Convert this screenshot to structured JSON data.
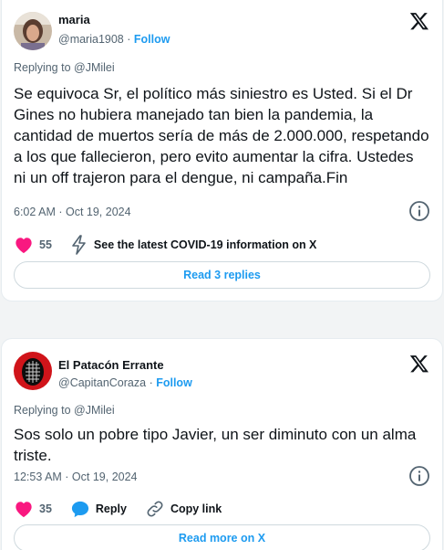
{
  "colors": {
    "accent": "#1d9bf0",
    "like": "#f91880",
    "muted": "#536471",
    "text": "#0f1419"
  },
  "tweets": [
    {
      "name": "maria",
      "handle": "@maria1908",
      "separator": "·",
      "follow_label": "Follow",
      "replying_to": "Replying to @JMilei",
      "text": "Se equivoca Sr, el político más siniestro es Usted. Si el Dr Gines no hubiera manejado tan bien la pandemia, la cantidad de muertos sería de más de 2.000.000, respetando a los que fallecieron, pero evito aumentar la cifra. Ustedes ni un off trajeron para el dengue, ni campaña.Fin",
      "timestamp": "6:02 AM · Oct 19, 2024",
      "likes": "55",
      "info_link": "See the latest COVID-19 information on X",
      "button_label": "Read 3 replies",
      "icons": [
        "x-logo-icon",
        "info-icon",
        "heart-icon",
        "covid-bolt-icon"
      ]
    },
    {
      "name": "El Patacón Errante",
      "handle": "@CapitanCoraza",
      "separator": "·",
      "follow_label": "Follow",
      "replying_to": "Replying to @JMilei",
      "text": "Sos solo un pobre tipo Javier, un ser diminuto con un alma triste.",
      "timestamp": "12:53 AM · Oct 19, 2024",
      "likes": "35",
      "reply_label": "Reply",
      "copy_label": "Copy link",
      "button_label": "Read more on X",
      "icons": [
        "x-logo-icon",
        "info-icon",
        "heart-icon",
        "reply-bubble-icon",
        "link-icon"
      ]
    }
  ]
}
